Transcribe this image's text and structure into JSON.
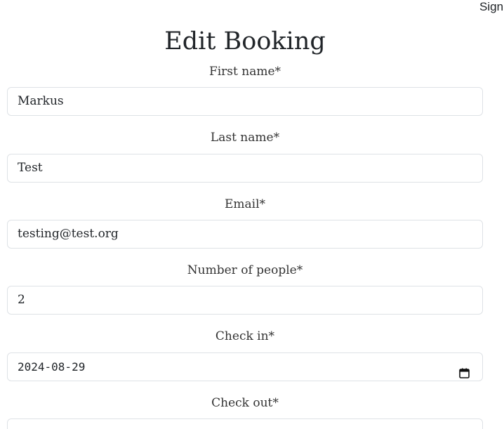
{
  "header": {
    "sign_link": "Sign"
  },
  "page": {
    "title": "Edit Booking"
  },
  "form": {
    "first_name": {
      "label": "First name*",
      "value": "Markus"
    },
    "last_name": {
      "label": "Last name*",
      "value": "Test"
    },
    "email": {
      "label": "Email*",
      "value": "testing@test.org"
    },
    "people": {
      "label": "Number of people*",
      "value": "2"
    },
    "check_in": {
      "label": "Check in*",
      "value": "2024-08-29",
      "icon": "calendar-icon"
    },
    "check_out": {
      "label": "Check out*",
      "value": "",
      "icon": "calendar-icon"
    }
  },
  "colors": {
    "text": "#212529",
    "border": "#dee2e6",
    "background": "#ffffff"
  }
}
